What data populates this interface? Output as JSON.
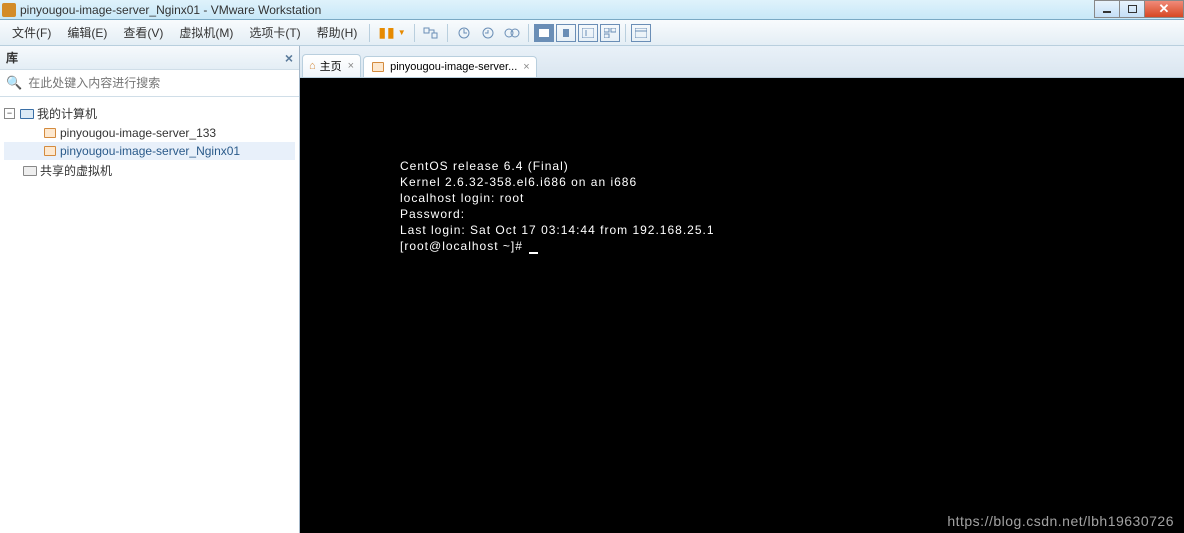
{
  "titlebar": {
    "title": "pinyougou-image-server_Nginx01 - VMware Workstation"
  },
  "menu": {
    "items": [
      "文件(F)",
      "编辑(E)",
      "查看(V)",
      "虚拟机(M)",
      "选项卡(T)",
      "帮助(H)"
    ]
  },
  "sidebar": {
    "header": "库",
    "search_placeholder": "在此处键入内容进行搜索",
    "my_computer": "我的计算机",
    "vm1": "pinyougou-image-server_133",
    "vm2": "pinyougou-image-server_Nginx01",
    "shared": "共享的虚拟机"
  },
  "tabs": {
    "home": "主页",
    "active": "pinyougou-image-server..."
  },
  "console": {
    "l1": "CentOS release 6.4 (Final)",
    "l2": "Kernel 2.6.32-358.el6.i686 on an i686",
    "l3": "",
    "l4": "localhost login: root",
    "l5": "Password:",
    "l6": "Last login: Sat Oct 17 03:14:44 from 192.168.25.1",
    "l7": "[root@localhost ~]# "
  },
  "watermark": "https://blog.csdn.net/lbh19630726"
}
